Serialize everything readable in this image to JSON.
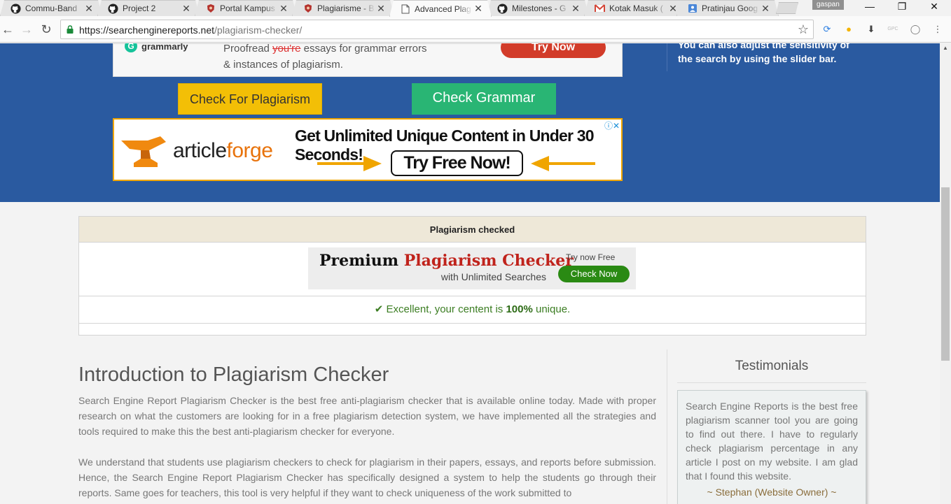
{
  "browser": {
    "tabs": [
      {
        "title": "Commu-Band",
        "icon": "github-icon"
      },
      {
        "title": "Project 2",
        "icon": "github-icon"
      },
      {
        "title": "Portal Kampus",
        "icon": "campus-icon"
      },
      {
        "title": "Plagiarisme - B",
        "icon": "campus-icon"
      },
      {
        "title": "Advanced Plag",
        "icon": "page-icon"
      },
      {
        "title": "Milestones - G",
        "icon": "github-icon"
      },
      {
        "title": "Kotak Masuk (",
        "icon": "gmail-icon"
      },
      {
        "title": "Pratinjau Goog",
        "icon": "forms-icon"
      }
    ],
    "close_glyph": "✕",
    "profile_name": "gaspan",
    "url_host": "https://searchenginereports.net",
    "url_path": "/plagiarism-checker/",
    "colors": {
      "tab_bg": "#e4e4e4",
      "active_tab_bg": "#fafafa",
      "gmail_red": "#d44638",
      "github": "#222222"
    }
  },
  "grammarly_ad": {
    "brand": "grammarly",
    "line1_prefix": "Proofread ",
    "line1_strike": "you're",
    "line1_suffix": " essays for grammar errors",
    "line2": "& instances of plagiarism.",
    "cta": "Try Now"
  },
  "hero": {
    "check_plagiarism_button": "Check For Plagiarism",
    "check_grammar_button": "Check Grammar",
    "side_text": "You can also adjust the sensitivity of the search by using the slider bar.",
    "colors": {
      "background": "#2a5aa0",
      "yellow_button": "#f3bf06",
      "green_button": "#29b574"
    }
  },
  "articleforge_ad": {
    "brand_prefix": "article",
    "brand_suffix": "forge",
    "headline": "Get Unlimited Unique Content in Under 30 Seconds!",
    "cta": "Try Free Now!",
    "adchoices": "ⓘ✕"
  },
  "results": {
    "header": "Plagiarism checked",
    "promo_title_1": "Premium ",
    "promo_title_2": "Plagiarism Checker",
    "promo_sub": "with Unlimited Searches",
    "promo_try": "Try now Free",
    "promo_button": "Check Now",
    "status_check": "✔",
    "status_prefix": " Excellent, your ",
    "status_word": "centent",
    "status_mid": " is ",
    "status_percent": "100%",
    "status_suffix": " unique."
  },
  "intro": {
    "title": "Introduction to Plagiarism Checker",
    "paragraph1": "Search Engine Report Plagiarism Checker is the best free anti-plagiarism checker that is available online today. Made with proper research on what the customers are looking for in a free plagiarism detection system, we have implemented all the strategies and tools required to make this the best anti-plagiarism checker for everyone.",
    "paragraph2": "We understand that students use plagiarism checkers to check for plagiarism in their papers, essays, and reports before submission. Hence, the Search Engine Report Plagiarism Checker has specifically designed a system to help the students go through their reports. Same goes for teachers, this tool is very helpful if they want to check uniqueness of the work submitted to"
  },
  "testimonials": {
    "title": "Testimonials",
    "text": "Search Engine Reports is the best free plagiarism scanner tool you are going to find out there. I have to regularly check plagiarism percentage in any article I post on my website. I am glad that I found this website.",
    "author": "~ Stephan (Website Owner) ~"
  }
}
